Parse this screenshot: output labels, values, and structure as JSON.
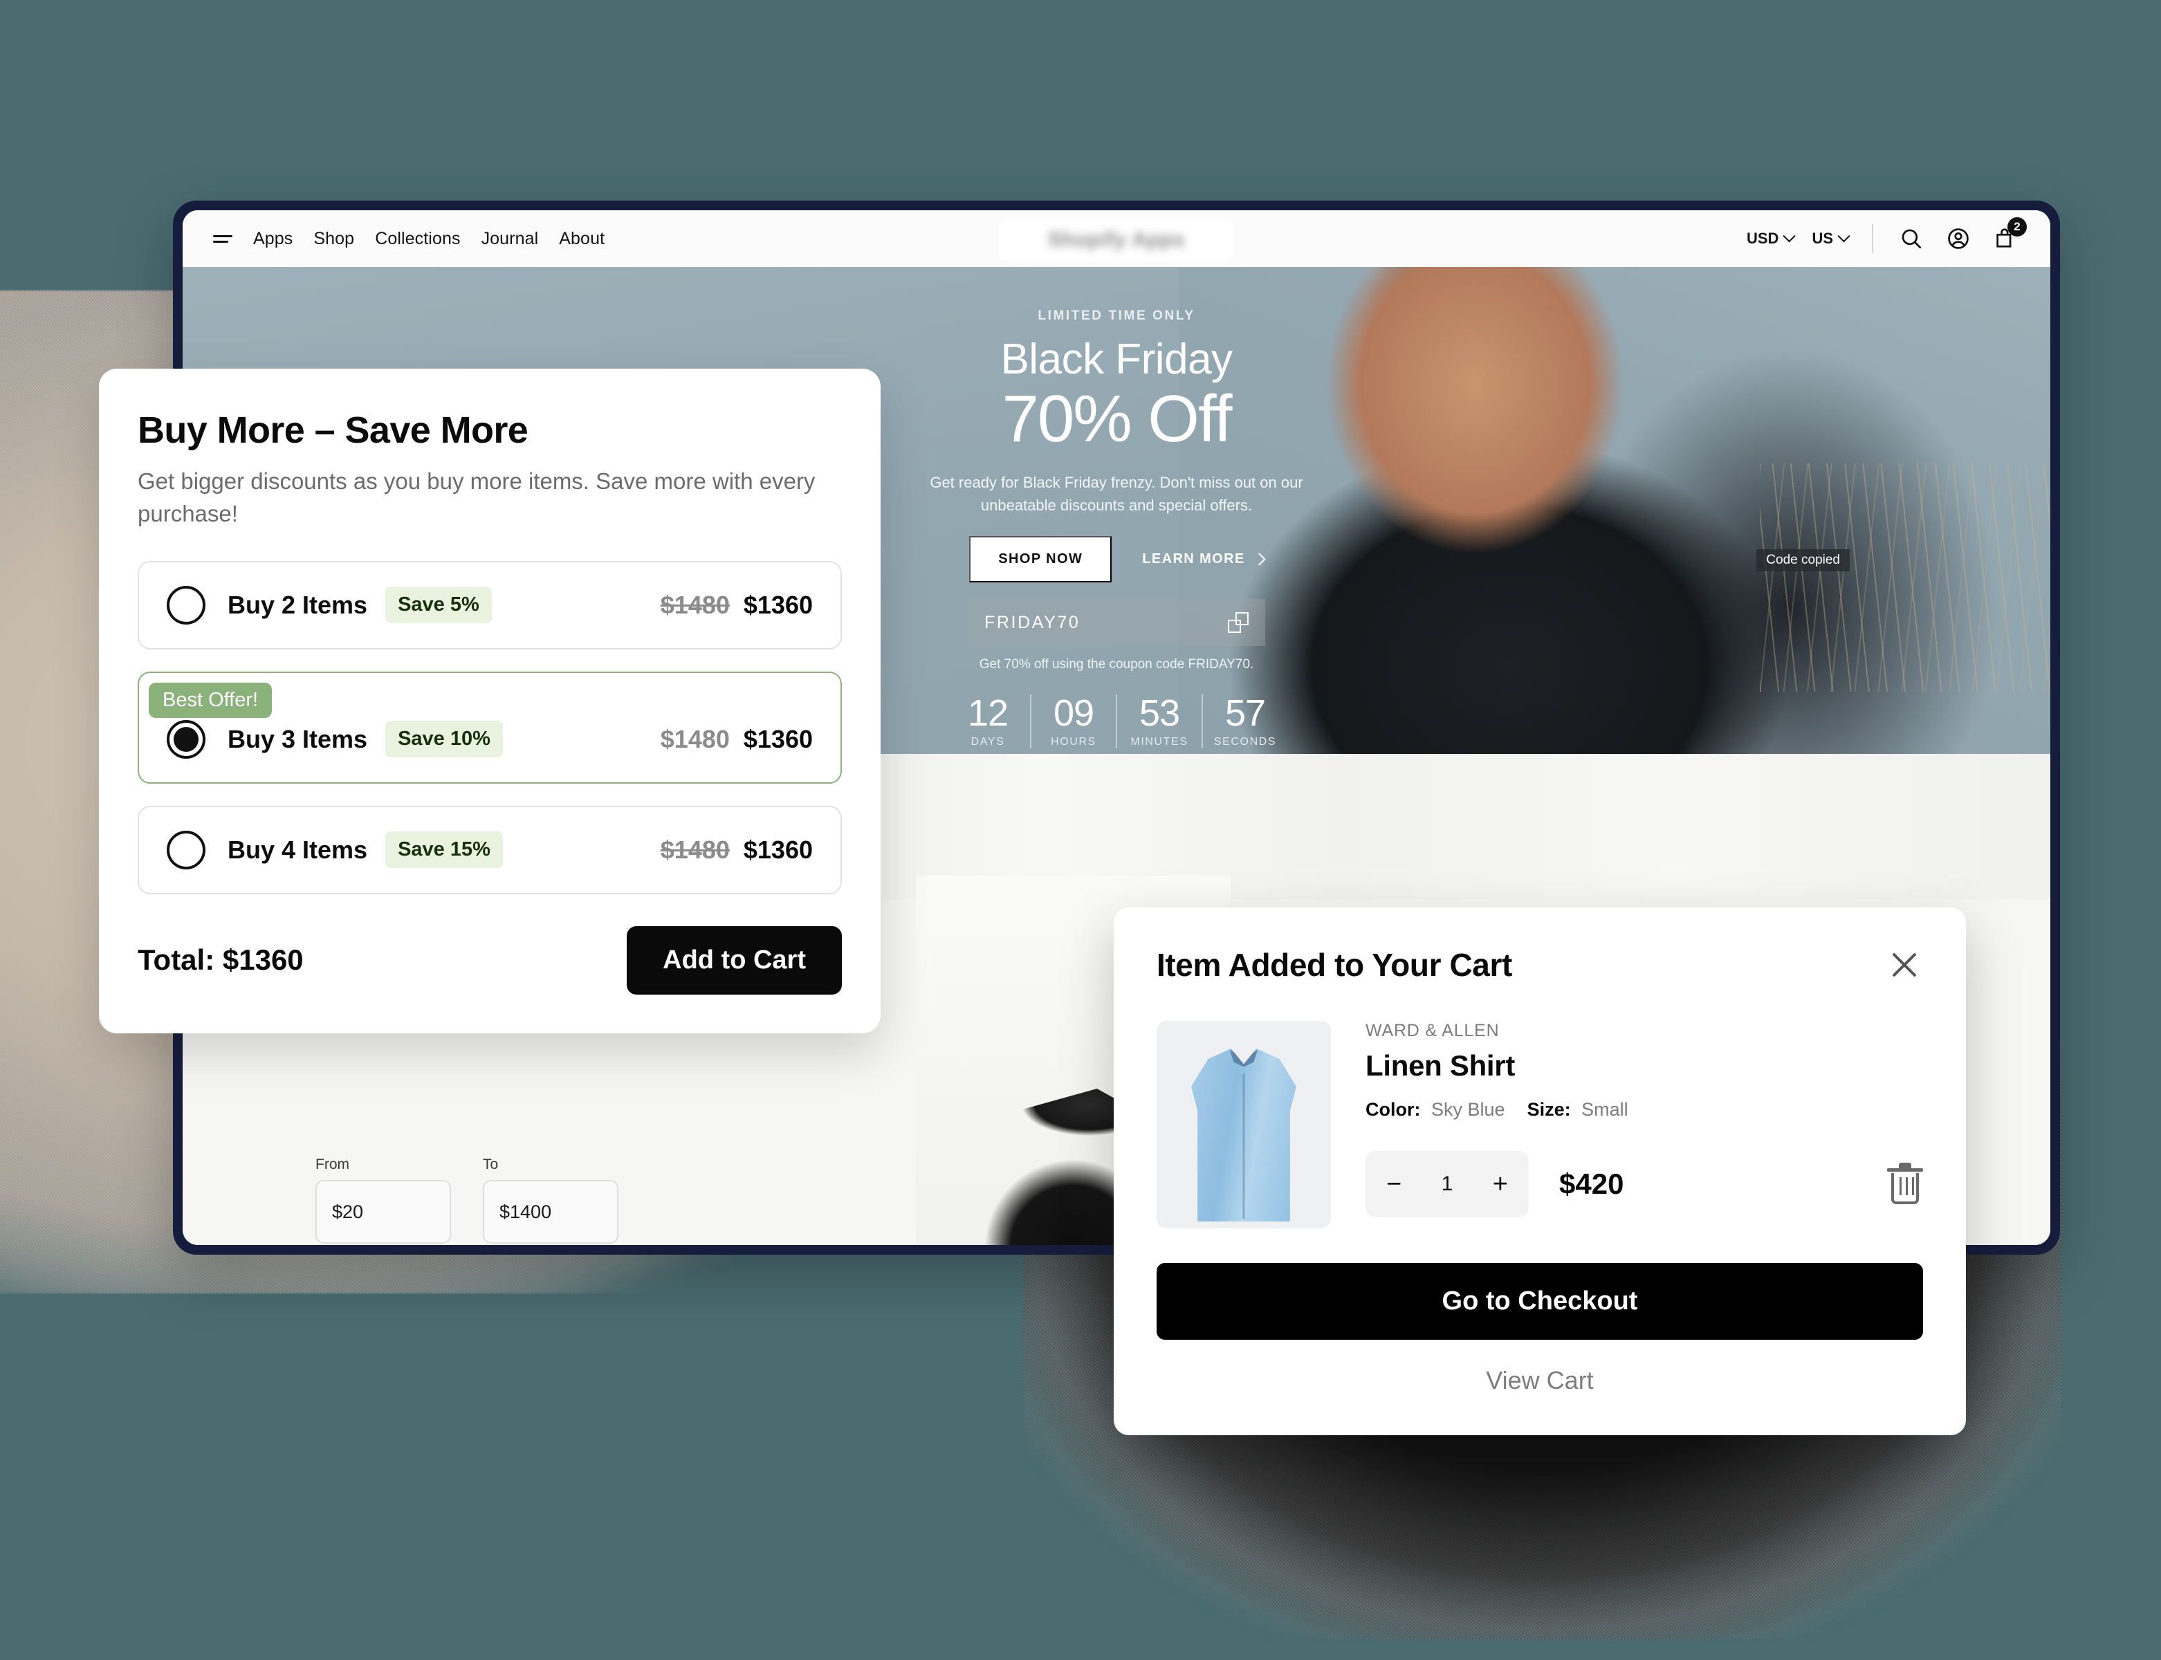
{
  "browser": {
    "nav": {
      "menu_icon": "hamburger-icon",
      "links": [
        "Apps",
        "Shop",
        "Collections",
        "Journal",
        "About"
      ],
      "logo_text": "Shopify Apps",
      "currency": "USD",
      "country": "US",
      "icons": [
        "search-icon",
        "account-icon",
        "cart-icon"
      ],
      "cart_count": "2"
    },
    "hero": {
      "kicker": "LIMITED TIME ONLY",
      "title": "Black Friday",
      "headline": "70% Off",
      "subtitle": "Get ready for Black Friday frenzy. Don't miss out on our unbeatable discounts and special offers.",
      "shop_button": "SHOP NOW",
      "learn_button": "LEARN MORE",
      "code_copied_tooltip": "Code copied",
      "coupon_code": "FRIDAY70",
      "coupon_note": "Get 70% off using the coupon code FRIDAY70.",
      "countdown": [
        {
          "value": "12",
          "label": "DAYS"
        },
        {
          "value": "09",
          "label": "HOURS"
        },
        {
          "value": "53",
          "label": "MINUTES"
        },
        {
          "value": "57",
          "label": "SECONDS"
        }
      ]
    },
    "price_filter": {
      "from_label": "From",
      "from_value": "$20",
      "to_label": "To",
      "to_value": "$1400"
    }
  },
  "buy_more_panel": {
    "title": "Buy More – Save More",
    "subtitle": "Get bigger discounts as you buy more items. Save more with every purchase!",
    "best_offer_badge": "Best Offer!",
    "tiers": [
      {
        "label": "Buy 2 Items",
        "save": "Save 5%",
        "price_old": "$1480",
        "price_new": "$1360",
        "selected": false,
        "best": false,
        "struck": true
      },
      {
        "label": "Buy 3 Items",
        "save": "Save 10%",
        "price_old": "$1480",
        "price_new": "$1360",
        "selected": true,
        "best": true,
        "struck": false
      },
      {
        "label": "Buy 4 Items",
        "save": "Save 15%",
        "price_old": "$1480",
        "price_new": "$1360",
        "selected": false,
        "best": false,
        "struck": true
      }
    ],
    "total_label": "Total: $1360",
    "add_to_cart_label": "Add to Cart"
  },
  "cart_modal": {
    "title": "Item Added to Your Cart",
    "close_icon": "close-icon",
    "product": {
      "brand": "WARD & ALLEN",
      "name": "Linen Shirt",
      "color_label": "Color:",
      "color_value": "Sky Blue",
      "size_label": "Size:",
      "size_value": "Small",
      "quantity": "1",
      "decrement": "−",
      "increment": "+",
      "price": "$420",
      "delete_icon": "trash-icon"
    },
    "checkout_label": "Go to Checkout",
    "view_cart_label": "View Cart"
  },
  "colors": {
    "page_background": "#4a6b70",
    "browser_frame": "#161d3c",
    "accent_green": "#8cb27c",
    "save_pill_bg": "#e9f3e0",
    "primary_button": "#0a0a0a"
  }
}
